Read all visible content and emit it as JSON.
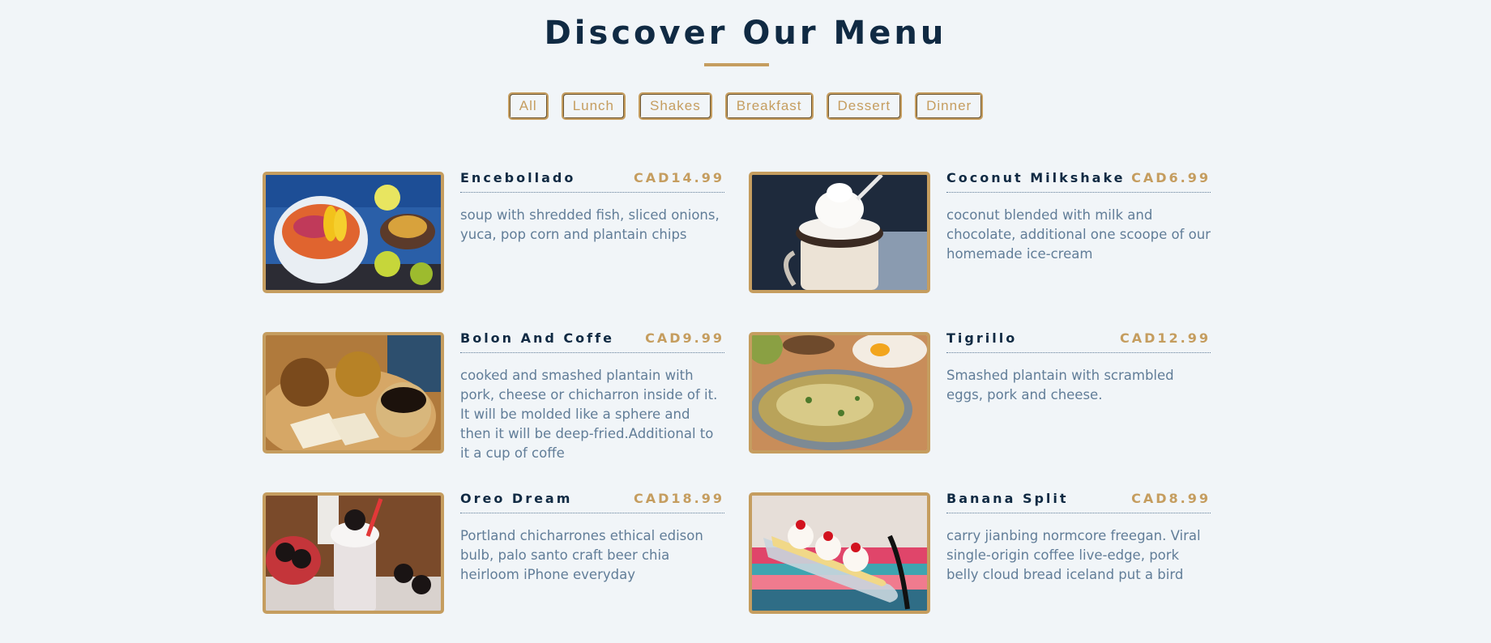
{
  "header": {
    "title": "Discover Our Menu"
  },
  "filters": [
    "All",
    "Lunch",
    "Shakes",
    "Breakfast",
    "Dessert",
    "Dinner"
  ],
  "menu": [
    {
      "name": "Encebollado",
      "price": "CAD14.99",
      "desc": "soup with shredded fish, sliced onions, yuca, pop corn and plantain chips"
    },
    {
      "name": "Coconut Milkshake",
      "price": "CAD6.99",
      "desc": "coconut blended with milk and chocolate, additional one scoope of our homemade ice-cream"
    },
    {
      "name": "Bolon And Coffe",
      "price": "CAD9.99",
      "desc": "cooked and smashed plantain with pork, cheese or chicharron inside of it. It will be molded like a sphere and then it will be deep-fried.Additional to it a cup of coffe"
    },
    {
      "name": "Tigrillo",
      "price": "CAD12.99",
      "desc": "Smashed plantain with scrambled eggs, pork and cheese."
    },
    {
      "name": "Oreo Dream",
      "price": "CAD18.99",
      "desc": "Portland chicharrones ethical edison bulb, palo santo craft beer chia heirloom iPhone everyday"
    },
    {
      "name": "Banana Split",
      "price": "CAD8.99",
      "desc": "carry jianbing normcore freegan. Viral single-origin coffee live-edge, pork belly cloud bread iceland put a bird"
    }
  ],
  "colors": {
    "accent": "#c59d5f",
    "heading": "#102a43",
    "text": "#617d98",
    "background": "#f1f5f8"
  }
}
